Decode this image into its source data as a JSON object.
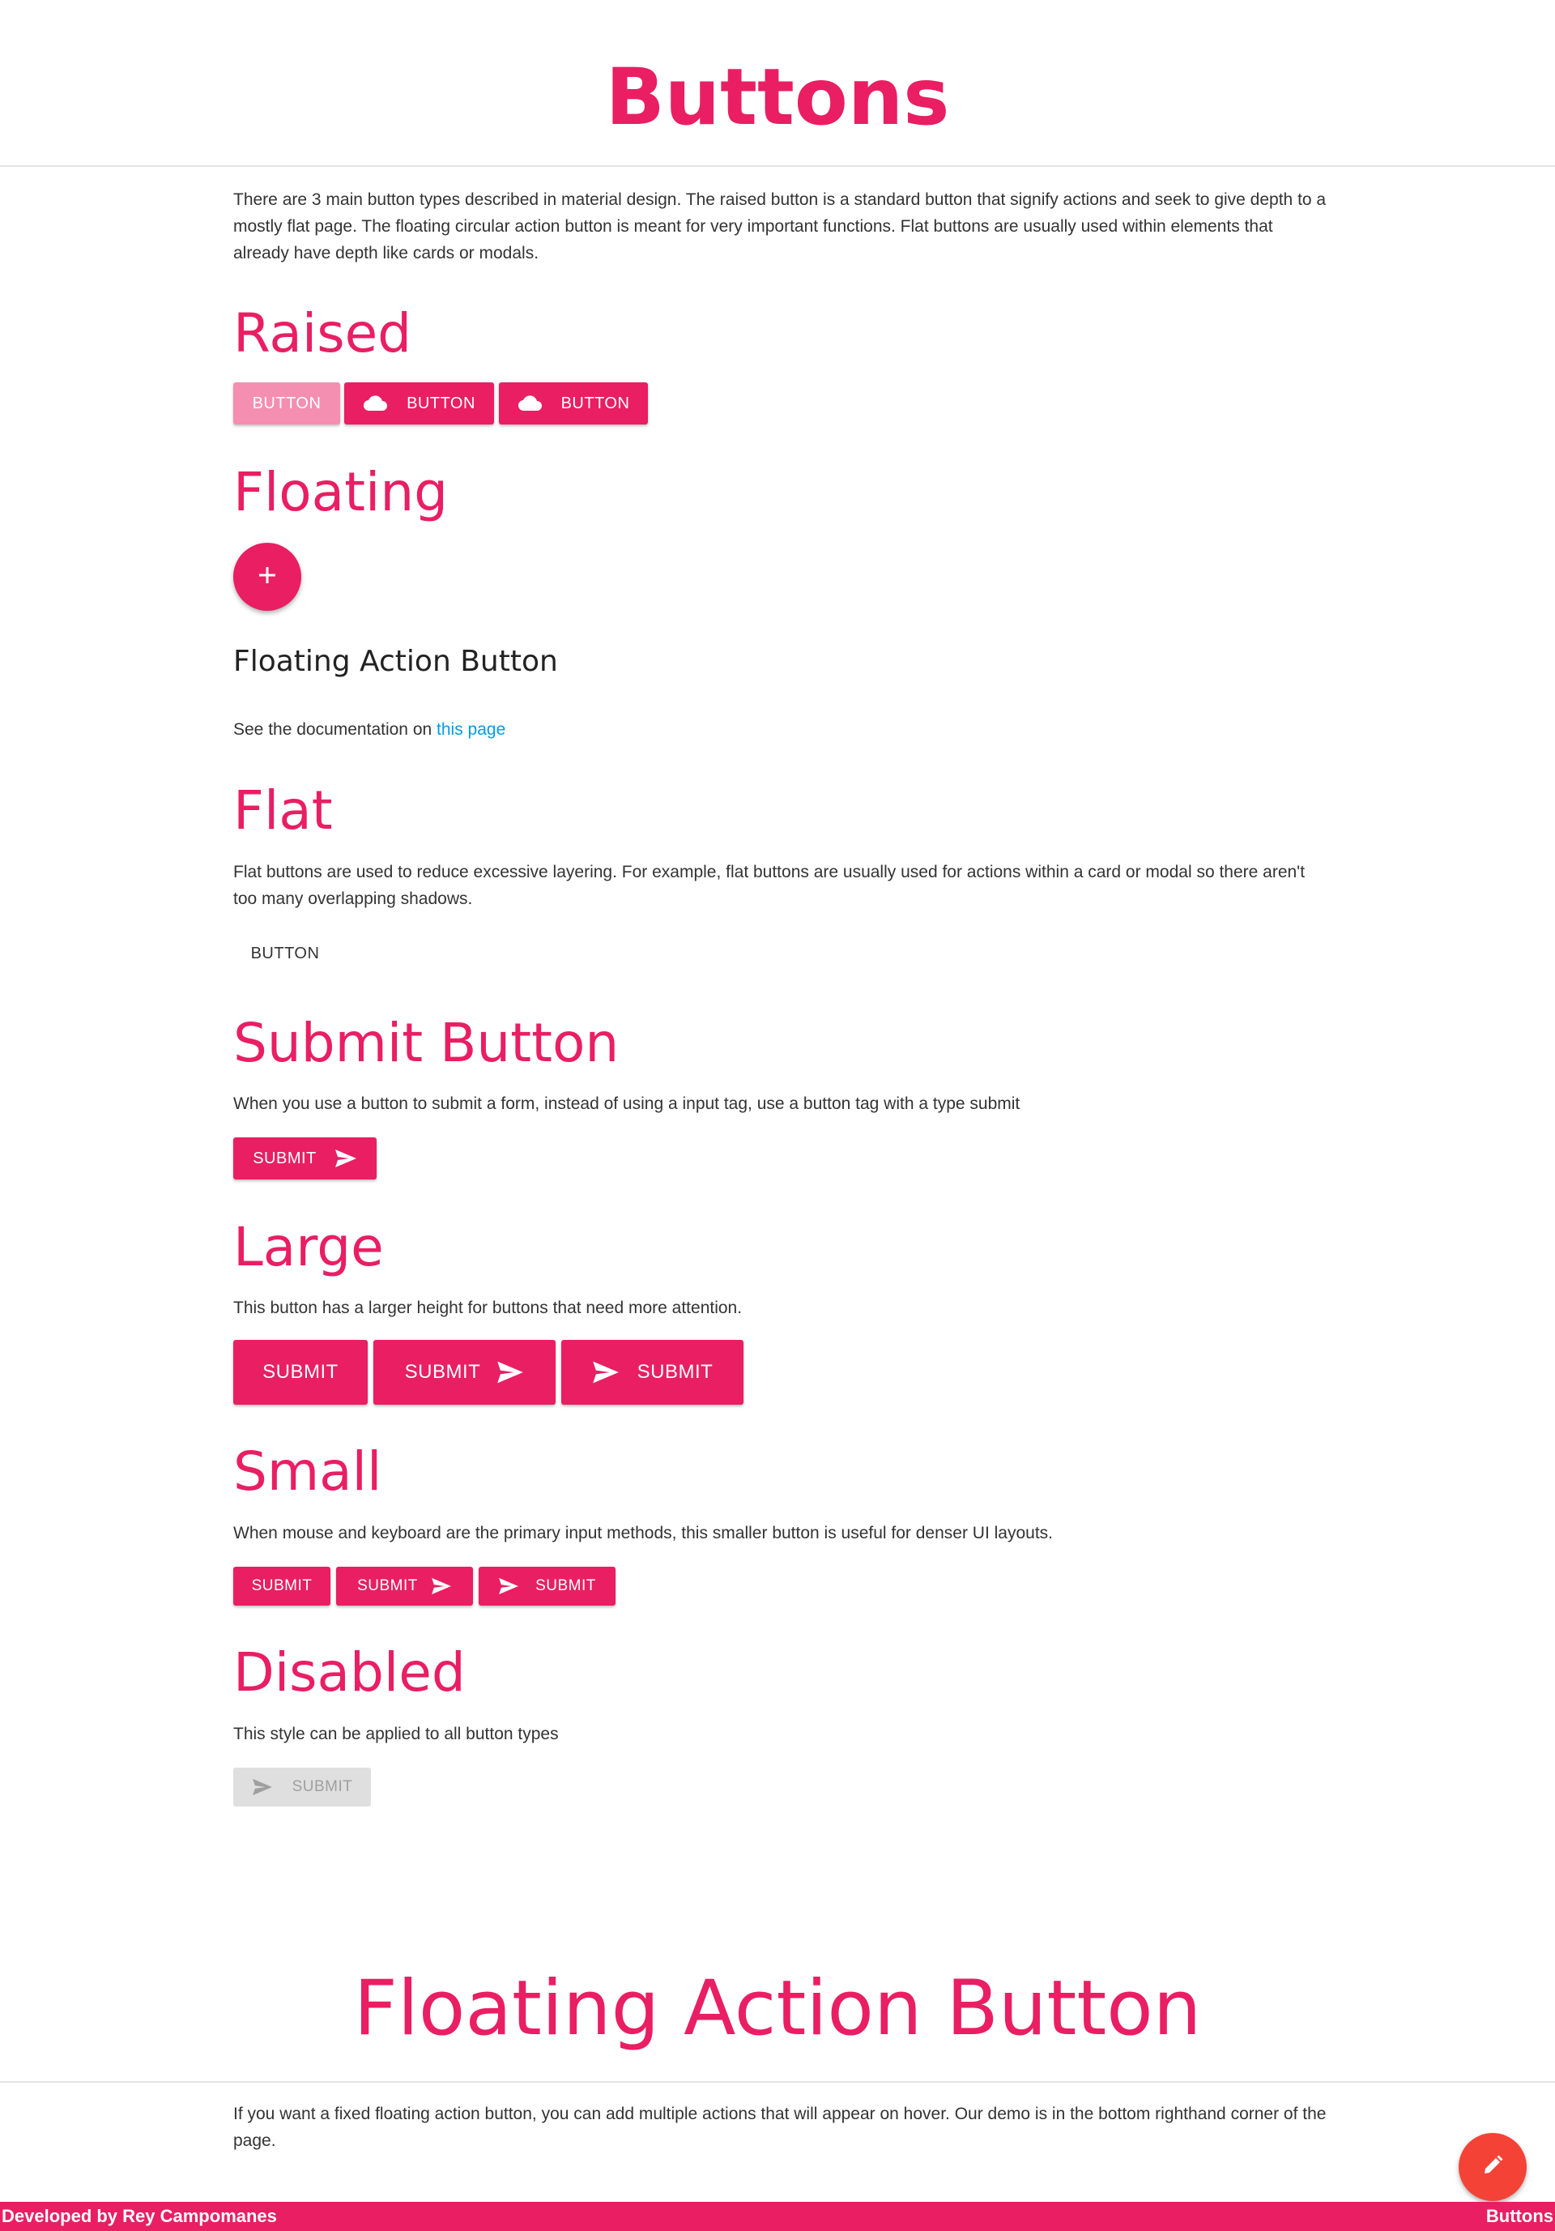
{
  "header": {
    "title": "Buttons"
  },
  "intro": "There are 3 main button types described in material design. The raised button is a standard button that signify actions and seek to give depth to a mostly flat page. The floating circular action button is meant for very important functions. Flat buttons are usually used within elements that already have depth like cards or modals.",
  "raised": {
    "heading": "Raised",
    "buttons": [
      "BUTTON",
      "BUTTON",
      "BUTTON"
    ],
    "icon": "cloud-icon"
  },
  "floating": {
    "heading": "Floating",
    "fab_icon": "plus-icon",
    "subheading": "Floating Action Button",
    "doc_text": "See the documentation on ",
    "doc_link": "this page"
  },
  "flat": {
    "heading": "Flat",
    "description": "Flat buttons are used to reduce excessive layering. For example, flat buttons are usually used for actions within a card or modal so there aren't too many overlapping shadows.",
    "button": "BUTTON"
  },
  "submit": {
    "heading": "Submit Button",
    "description": "When you use a button to submit a form, instead of using a input tag, use a button tag with a type submit",
    "button": "SUBMIT",
    "icon": "send-icon"
  },
  "large": {
    "heading": "Large",
    "description": "This button has a larger height for buttons that need more attention.",
    "buttons": [
      "SUBMIT",
      "SUBMIT",
      "SUBMIT"
    ]
  },
  "small": {
    "heading": "Small",
    "description": "When mouse and keyboard are the primary input methods, this smaller button is useful for denser UI layouts.",
    "buttons": [
      "SUBMIT",
      "SUBMIT",
      "SUBMIT"
    ]
  },
  "disabled": {
    "heading": "Disabled",
    "description": "This style can be applied to all button types",
    "button": "SUBMIT"
  },
  "fab_section": {
    "title": "Floating Action Button",
    "description": "If you want a fixed floating action button, you can add multiple actions that will appear on hover. Our demo is in the bottom righthand corner of the page.",
    "fixed_fab_icon": "pencil-icon"
  },
  "footer": {
    "left": "Developed by Rey Campomanes",
    "right": "Buttons"
  },
  "colors": {
    "accent": "#e91e63",
    "accent_light": "#f48fb1",
    "link": "#039be5",
    "fixed_fab": "#f44336",
    "disabled": "#dfdfdf"
  }
}
